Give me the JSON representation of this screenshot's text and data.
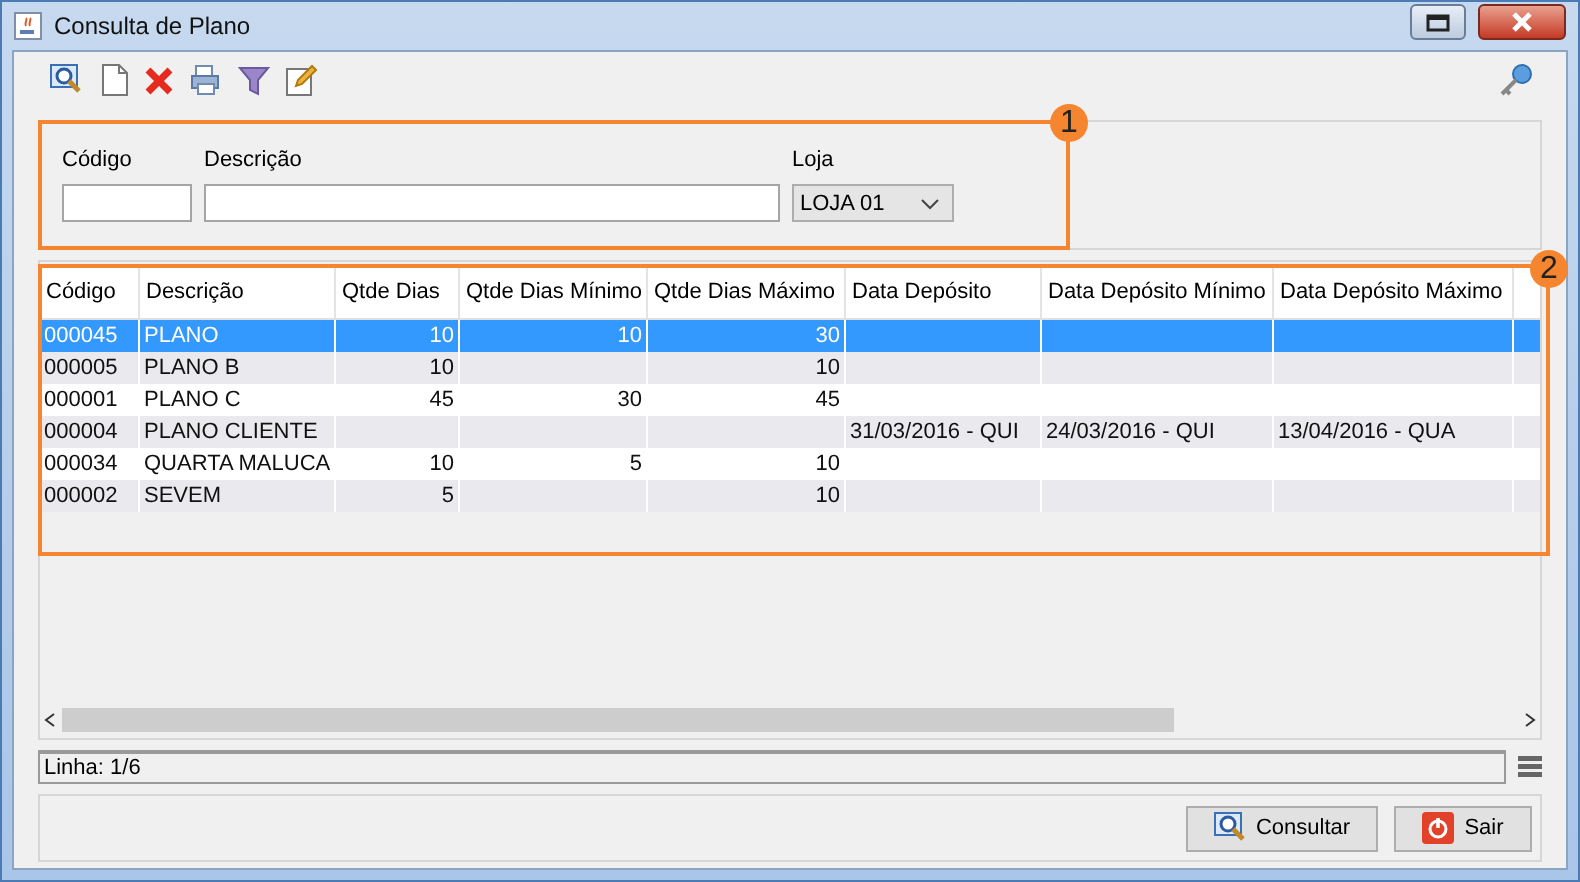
{
  "window": {
    "title": "Consulta de Plano"
  },
  "filters": {
    "codigo": {
      "label": "Código"
    },
    "descricao": {
      "label": "Descrição"
    },
    "loja": {
      "label": "Loja",
      "value": "LOJA 01"
    }
  },
  "callouts": [
    {
      "number": "1"
    },
    {
      "number": "2"
    }
  ],
  "table": {
    "columns": [
      {
        "label": "Código",
        "kind": "text"
      },
      {
        "label": "Descrição",
        "kind": "text"
      },
      {
        "label": "Qtde Dias",
        "kind": "number"
      },
      {
        "label": "Qtde Dias Mínimo",
        "kind": "number"
      },
      {
        "label": "Qtde Dias Máximo",
        "kind": "number"
      },
      {
        "label": "Data Depósito",
        "kind": "text"
      },
      {
        "label": "Data Depósito Mínimo",
        "kind": "text"
      },
      {
        "label": "Data Depósito Máximo",
        "kind": "text"
      }
    ],
    "rows": [
      {
        "selected": true,
        "cells": [
          "000045",
          "PLANO",
          "10",
          "10",
          "30",
          "",
          "",
          ""
        ]
      },
      {
        "selected": false,
        "cells": [
          "000005",
          "PLANO B",
          "10",
          "",
          "10",
          "",
          "",
          ""
        ]
      },
      {
        "selected": false,
        "cells": [
          "000001",
          "PLANO C",
          "45",
          "30",
          "45",
          "",
          "",
          ""
        ]
      },
      {
        "selected": false,
        "cells": [
          "000004",
          "PLANO CLIENTE",
          "",
          "",
          "",
          "31/03/2016 - QUI",
          "24/03/2016 - QUI",
          "13/04/2016 - QUA"
        ]
      },
      {
        "selected": false,
        "cells": [
          "000034",
          "QUARTA MALUCA",
          "10",
          "5",
          "10",
          "",
          "",
          ""
        ]
      },
      {
        "selected": false,
        "cells": [
          "000002",
          "SEVEM",
          "5",
          "",
          "10",
          "",
          "",
          ""
        ]
      }
    ]
  },
  "status_bar": {
    "text": "Linha: 1/6"
  },
  "buttons": [
    {
      "label": "Consultar",
      "kind": "search"
    },
    {
      "label": "Sair",
      "kind": "exit"
    }
  ]
}
